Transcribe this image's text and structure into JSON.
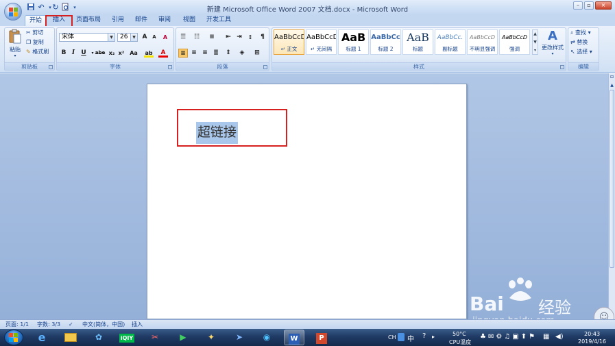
{
  "window": {
    "title": "新建 Microsoft Office Word 2007 文档.docx - Microsoft Word",
    "minimize": "–",
    "restore": "▫",
    "close": "×"
  },
  "quick_access": {
    "save_icon": "save-icon",
    "undo": "↶",
    "redo": "↻",
    "print_icon": "print-preview-icon"
  },
  "tabs": [
    "开始",
    "插入",
    "页面布局",
    "引用",
    "邮件",
    "审阅",
    "视图",
    "开发工具"
  ],
  "active_tab": "开始",
  "highlighted_tab": "插入",
  "clipboard": {
    "paste": "粘贴",
    "cut": "剪切",
    "copy": "复制",
    "format_painter": "格式刷",
    "group_label": "剪贴板"
  },
  "font": {
    "font_name": "宋体",
    "font_size": "26",
    "grow": "A",
    "shrink": "A",
    "clear": "A",
    "bold": "B",
    "italic": "I",
    "underline": "U",
    "strike": "abe",
    "subscript": "x₂",
    "superscript": "x²",
    "change_case": "Aa",
    "highlight": "ab",
    "font_color": "A",
    "group_label": "字体"
  },
  "paragraph": {
    "group_label": "段落"
  },
  "styles": {
    "items": [
      {
        "sample": "AaBbCcD",
        "name": "↵ 正文"
      },
      {
        "sample": "AaBbCcD",
        "name": "↵ 无间隔"
      },
      {
        "sample": "AaB",
        "name": "标题 1"
      },
      {
        "sample": "AaBbCc",
        "name": "标题 2"
      },
      {
        "sample": "AaB",
        "name": "标题"
      },
      {
        "sample": "AaBbCc.",
        "name": "副标题"
      },
      {
        "sample": "AaBbCcD",
        "name": "不明显强调"
      },
      {
        "sample": "AaBbCcD",
        "name": "强调"
      }
    ],
    "change_styles": "更改样式",
    "group_label": "样式"
  },
  "editing": {
    "find": "查找",
    "replace": "替换",
    "select": "选择",
    "group_label": "编辑"
  },
  "document": {
    "text": "超链接"
  },
  "status": {
    "page": "页面: 1/1",
    "words": "字数: 3/3",
    "language": "中文(简体，中国)",
    "insert_mode": "插入"
  },
  "taskbar": {
    "apps": [
      "ie-icon",
      "explorer-icon",
      "photos-icon",
      "iqiyi-icon",
      "snipping-icon",
      "media-player-icon",
      "tool-icon",
      "feishu-icon",
      "browser-icon",
      "word-icon",
      "powerpoint-icon"
    ],
    "iqiyi_label": "iQIY",
    "ime_ch": "CH",
    "ime_zh": "中",
    "temperature": "50°C",
    "cpu": "CPU温度",
    "time": "20:43",
    "date": "2019/4/16"
  },
  "watermark": {
    "brand": "Bai",
    "brand2": "经验",
    "url": "jingyan.baidu.com"
  },
  "colors": {
    "ribbon": "#dbe8f7",
    "workspace": "#a3bbdf",
    "highlight_box": "#d62020",
    "selection": "#a9c7ea",
    "selected_style": "#fde7b8"
  }
}
